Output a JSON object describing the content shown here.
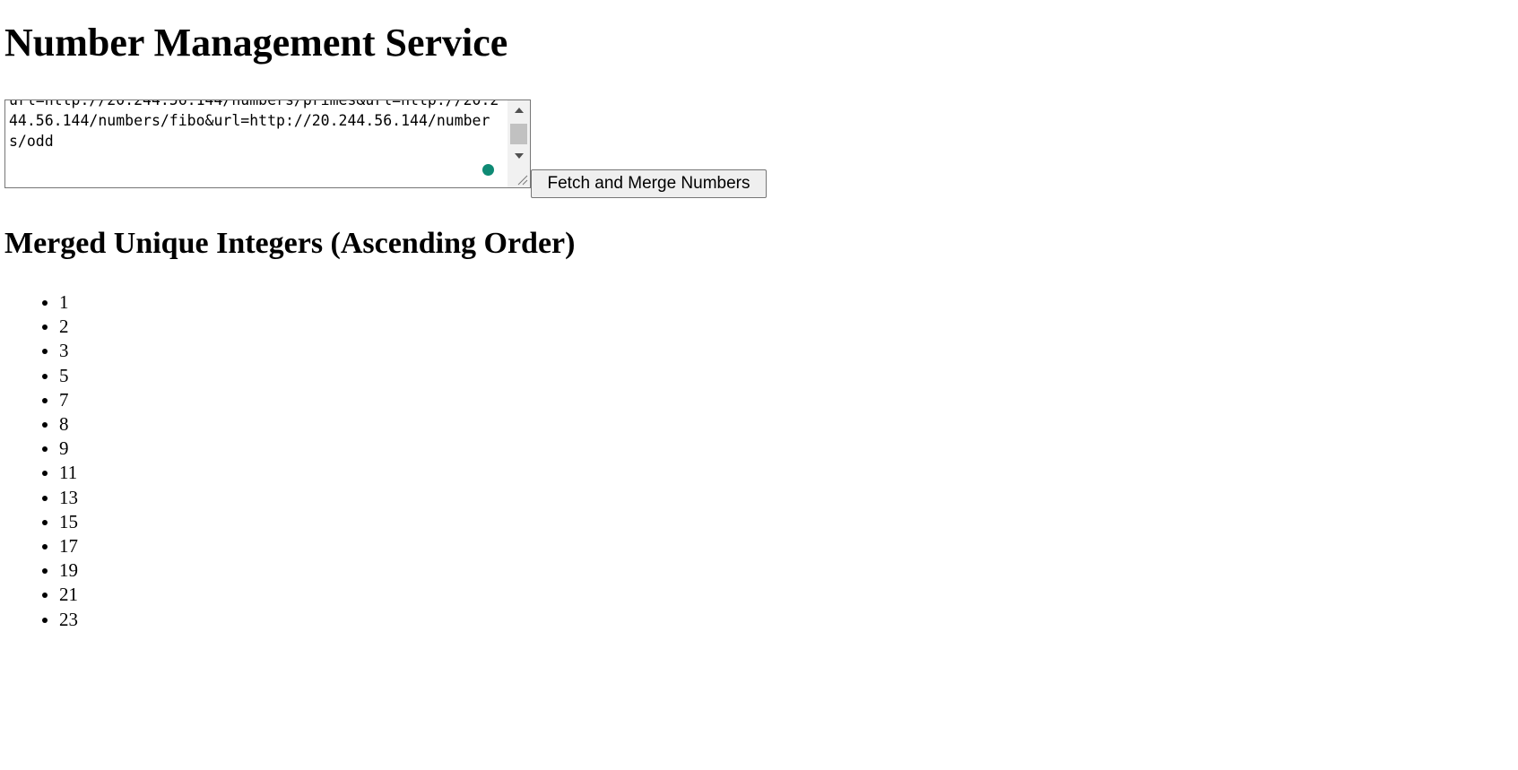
{
  "page": {
    "title": "Number Management Service"
  },
  "url_input": {
    "value": "url=http://20.244.56.144/numbers/primes&url=http://20.244.56.144/numbers/fibo&url=http://20.244.56.144/numbers/odd"
  },
  "fetch_button": {
    "label": "Fetch and Merge Numbers"
  },
  "results": {
    "heading": "Merged Unique Integers (Ascending Order)",
    "numbers": [
      "1",
      "2",
      "3",
      "5",
      "7",
      "8",
      "9",
      "11",
      "13",
      "15",
      "17",
      "19",
      "21",
      "23"
    ]
  },
  "colors": {
    "status_dot": "#0e8a74"
  },
  "icons": {
    "scroll_up": "triangle-up",
    "scroll_down": "triangle-down",
    "resize": "diagonal-grip"
  }
}
